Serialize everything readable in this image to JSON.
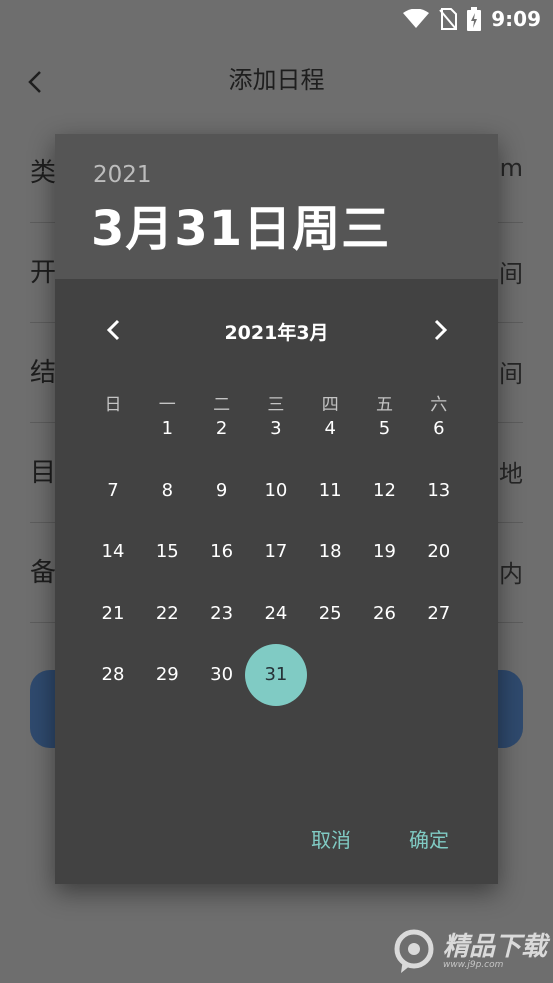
{
  "statusbar": {
    "time": "9:09",
    "icons": [
      "wifi-icon",
      "no-sim-icon",
      "battery-charging-icon"
    ]
  },
  "page": {
    "title": "添加日程",
    "rows": [
      {
        "label": "类",
        "value": "m"
      },
      {
        "label": "开",
        "value": "间"
      },
      {
        "label": "结",
        "value": "间"
      },
      {
        "label": "目",
        "value": "地"
      },
      {
        "label": "备",
        "value": "内"
      }
    ]
  },
  "dialog": {
    "year": "2021",
    "selected_date": "3月31日周三",
    "month_title": "2021年3月",
    "weekdays": [
      "日",
      "一",
      "二",
      "三",
      "四",
      "五",
      "六"
    ],
    "start_weekday": 1,
    "days_in_month": 31,
    "selected_day": 31,
    "cancel_label": "取消",
    "ok_label": "确定"
  },
  "colors": {
    "accent": "#80cbc4",
    "dialog_bg": "#424242",
    "header_bg": "#555555"
  },
  "watermark": {
    "text": "精品下载",
    "url": "www.j9p.com"
  }
}
